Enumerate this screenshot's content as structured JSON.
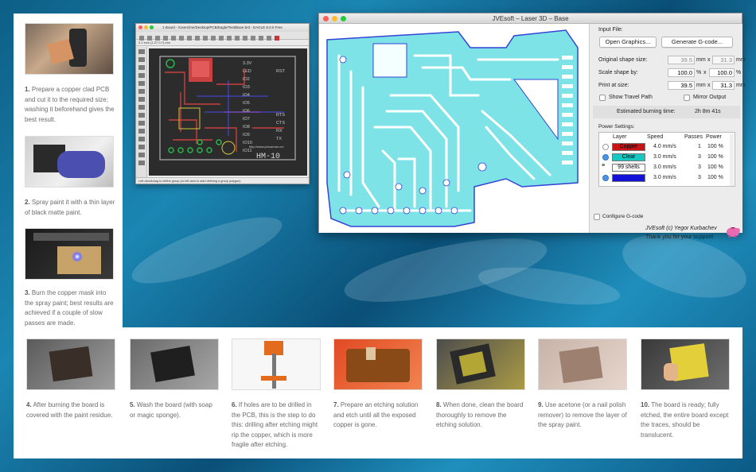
{
  "left_steps": [
    {
      "num": "1.",
      "text": "Prepare a copper clad PCB and cut it to the required size; washing it beforehand gives the best result."
    },
    {
      "num": "2.",
      "text": "Spray paint it with a thin layer of black matte paint."
    },
    {
      "num": "3.",
      "text": "Burn the copper mask into the spray paint; best results are achieved if a couple of slow passes are made."
    }
  ],
  "bottom_steps": [
    {
      "num": "4.",
      "text": "After burning the board is covered with the paint residue."
    },
    {
      "num": "5.",
      "text": "Wash the board (with soap or magic sponge)."
    },
    {
      "num": "6.",
      "text": "If holes are to be drilled in the PCB, this is the step to do this: drilling after etching might rip the copper, which is more fragile after etching."
    },
    {
      "num": "7.",
      "text": "Prepare an etching solution and etch until all the exposed copper is gone."
    },
    {
      "num": "8.",
      "text": "When done, clean the board thoroughly to remove the etching solution."
    },
    {
      "num": "9.",
      "text": "Use acetone (or a nail polish remover) to remove the layer of the spray paint."
    },
    {
      "num": "10.",
      "text": "The board is ready; fully etched, the entire board except the traces, should be translucent."
    }
  ],
  "eagle": {
    "title": "1 Board - /Users/me/Desktop/PCB/Eagle/Test/Base.brd - EAGLE 8.0.0 Free",
    "coord": "0.1 inch (1.27 0.7) mm",
    "status": "Left-click&drag to define group (or left-click to start defining a group polygon)",
    "board_label": "HM-10",
    "url": "http://www.jnhuamao.cn/",
    "pins": [
      "3.3V",
      "LED",
      "IO2",
      "IO3",
      "IO4",
      "IO5",
      "IO6",
      "IO7",
      "IO8",
      "IO9",
      "IO10",
      "IO11"
    ],
    "right_pins": [
      "RST",
      "RTS",
      "CTS",
      "RX",
      "TX"
    ]
  },
  "laser": {
    "title": "JVEsoft – Laser 3D – Base",
    "input_file_label": "Input File:",
    "open_graphics": "Open Graphics...",
    "generate_gcode": "Generate G-code...",
    "original_size_label": "Original shape size:",
    "original_w": "39.5",
    "original_h": "31.3",
    "scale_label": "Scale shape by:",
    "scale_x": "100.0",
    "scale_y": "100.0",
    "print_label": "Print at size:",
    "print_w": "39.5",
    "print_h": "31.3",
    "unit_mm": "mm",
    "unit_x": "x",
    "unit_pct": "%",
    "show_travel": "Show Travel Path",
    "mirror_output": "Mirror Output",
    "burn_time_label": "Estimated burning time:",
    "burn_time": "2h 8m 41s",
    "power_settings_label": "Power Settings:",
    "table_headers": [
      "Layer",
      "Speed",
      "Passes",
      "Power"
    ],
    "rows": [
      {
        "layer": "Copper",
        "color": "#c81414",
        "text_color": "#000",
        "speed": "4.0 mm/s",
        "passes": "1",
        "power": "100 %"
      },
      {
        "layer": "Clear",
        "color": "#17c7c2",
        "text_color": "#000",
        "speed": "3.0 mm/s",
        "passes": "3",
        "power": "100 %"
      },
      {
        "layer": "99 shells",
        "color": "#ffffff",
        "text_color": "#000",
        "speed": "3.0 mm/s",
        "passes": "3",
        "power": "100 %"
      },
      {
        "layer": "",
        "color": "#1212d8",
        "text_color": "#fff",
        "speed": "3.0 mm/s",
        "passes": "3",
        "power": "100 %"
      }
    ],
    "configure_gcode": "Configure G-code",
    "credit": "JVEsoft (c) Yegor Kurbachev",
    "thanks": "Thank you for your support!"
  },
  "colors": {
    "trace_cyan": "#7de3e6",
    "outline_blue": "#3344d6",
    "copper_red": "#c81414"
  }
}
